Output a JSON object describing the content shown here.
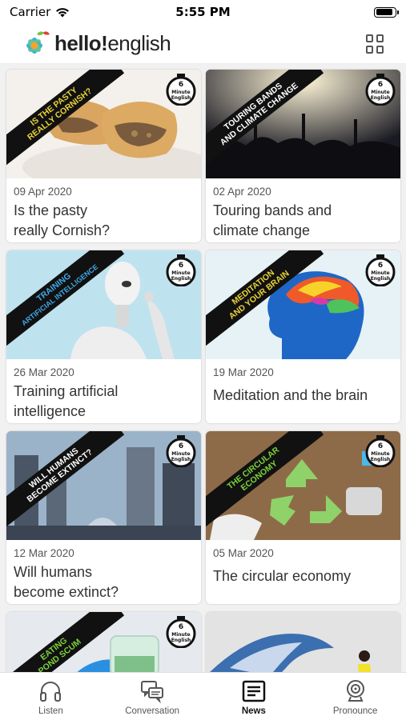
{
  "status_bar": {
    "carrier": "Carrier",
    "time": "5:55 PM"
  },
  "header": {
    "logo_text_bold": "hello!",
    "logo_text_rest": "english",
    "menu_icon": "grid-icon"
  },
  "cards": [
    {
      "banner_line1": "IS THE PASTY",
      "banner_line2": "REALLY CORNISH?",
      "banner_color": "#e8d23a",
      "date": "09 Apr 2020",
      "title_line1": "Is the pasty",
      "title_line2": "really Cornish?",
      "image": "pasty-photo"
    },
    {
      "banner_line1": "TOURING BANDS",
      "banner_line2": "AND CLIMATE CHANGE",
      "banner_color": "#ffffff",
      "date": "02 Apr 2020",
      "title_line1": "Touring bands and",
      "title_line2": "climate change",
      "image": "concert-crowd-photo"
    },
    {
      "banner_line1": "TRAINING",
      "banner_line2": "ARTIFICIAL INTELLIGENCE",
      "banner_color": "#3fa9e8",
      "date": "26 Mar 2020",
      "title_line1": "Training artificial",
      "title_line2": "intelligence",
      "image": "robot-photo"
    },
    {
      "banner_line1": "MEDITATION",
      "banner_line2": "AND YOUR BRAIN",
      "banner_color": "#e8d23a",
      "date": "19 Mar 2020",
      "title_line1": "Meditation and the brain",
      "title_line2": "",
      "image": "colorful-head-illustration"
    },
    {
      "banner_line1": "WILL HUMANS",
      "banner_line2": "BECOME EXTINCT?",
      "banner_color": "#ffffff",
      "date": "12 Mar 2020",
      "title_line1": "Will humans",
      "title_line2": "become extinct?",
      "image": "ruined-city-illustration"
    },
    {
      "banner_line1": "THE CIRCULAR",
      "banner_line2": "ECONOMY",
      "banner_color": "#7bd13b",
      "date": "05 Mar 2020",
      "title_line1": "The circular economy",
      "title_line2": "",
      "image": "recycling-photo"
    },
    {
      "banner_line1": "EATING",
      "banner_line2": "POND SCUM",
      "banner_color": "#7bd13b",
      "date": "",
      "title_line1": "",
      "title_line2": "",
      "image": "lab-gloves-photo"
    },
    {
      "banner_line1": "",
      "banner_line2": "",
      "banner_color": "#ffffff",
      "date": "",
      "title_line1": "",
      "title_line2": "",
      "image": "runner-wave-photo"
    }
  ],
  "badge": {
    "line1": "6",
    "line2": "Minute",
    "line3": "English"
  },
  "tabs": [
    {
      "label": "Listen",
      "icon": "headphones-icon",
      "active": false
    },
    {
      "label": "Conversation",
      "icon": "chat-bubbles-icon",
      "active": false
    },
    {
      "label": "News",
      "icon": "newspaper-icon",
      "active": true
    },
    {
      "label": "Pronounce",
      "icon": "webcam-icon",
      "active": false
    }
  ]
}
